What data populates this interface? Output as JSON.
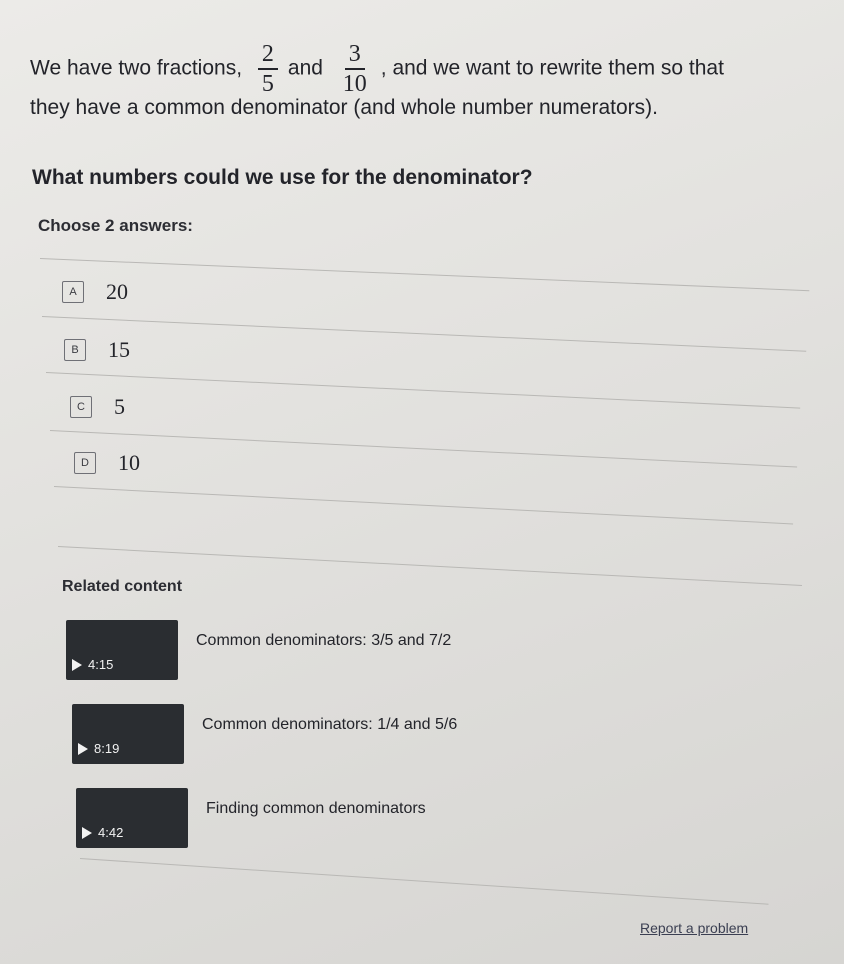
{
  "question": {
    "intro": "We have two fractions,",
    "fraction1": {
      "numerator": "2",
      "denominator": "5"
    },
    "conjunction": "and",
    "fraction2": {
      "numerator": "3",
      "denominator": "10"
    },
    "line1_end": ", and we want to rewrite them so that",
    "line2": "they have a common denominator (and whole number numerators)."
  },
  "prompt": "What numbers could we use for the denominator?",
  "instruction": "Choose 2 answers:",
  "choices": [
    {
      "letter": "A",
      "value": "20"
    },
    {
      "letter": "B",
      "value": "15"
    },
    {
      "letter": "C",
      "value": "5"
    },
    {
      "letter": "D",
      "value": "10"
    }
  ],
  "related": {
    "title": "Related content",
    "videos": [
      {
        "title": "Common denominators: 3/5 and 7/2",
        "duration": "4:15"
      },
      {
        "title": "Common denominators: 1/4 and 5/6",
        "duration": "8:19"
      },
      {
        "title": "Finding common denominators",
        "duration": "4:42"
      }
    ]
  },
  "report_link": "Report a problem"
}
